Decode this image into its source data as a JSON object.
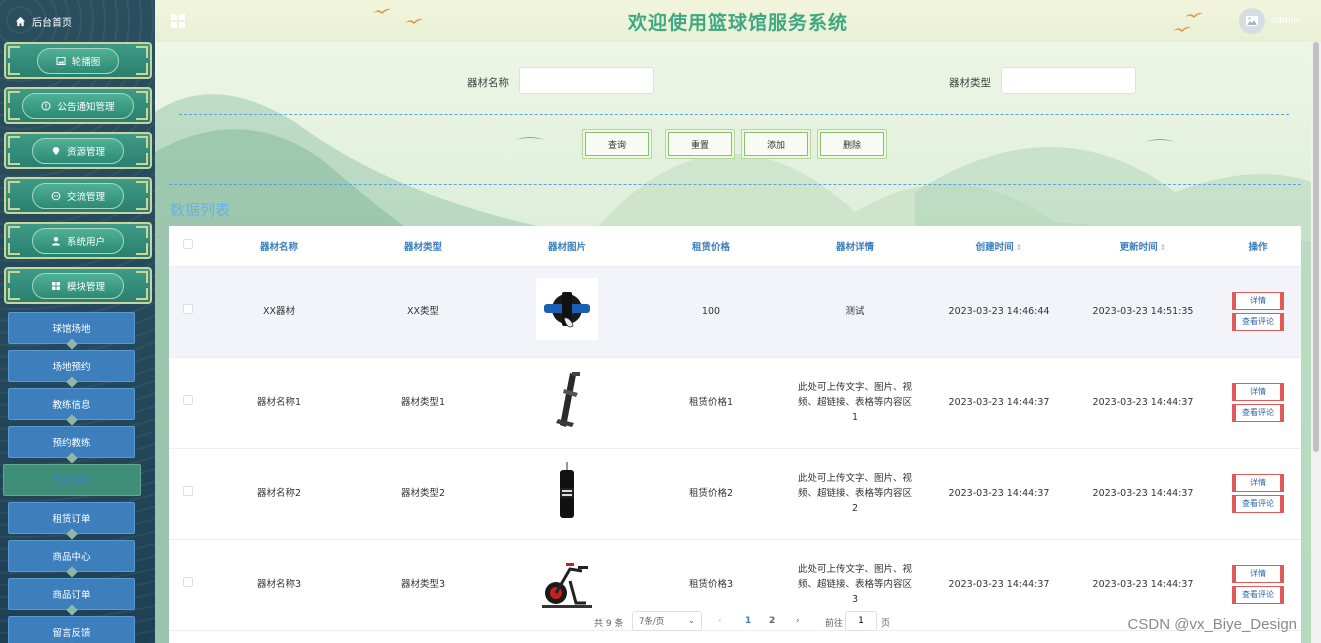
{
  "header": {
    "title": "欢迎使用篮球馆服务系统",
    "username": "admin"
  },
  "sidebar": {
    "home": "后台首页",
    "groups": [
      {
        "label": "轮播图",
        "icon": "image-icon"
      },
      {
        "label": "公告通知管理",
        "icon": "info-circle-icon"
      },
      {
        "label": "资源管理",
        "icon": "location-pin-icon"
      },
      {
        "label": "交流管理",
        "icon": "chat-bubble-icon"
      },
      {
        "label": "系统用户",
        "icon": "user-icon"
      },
      {
        "label": "模块管理",
        "icon": "grid-icon"
      }
    ],
    "items": [
      {
        "label": "球馆场地"
      },
      {
        "label": "场地预约"
      },
      {
        "label": "教练信息"
      },
      {
        "label": "预约教练"
      },
      {
        "label": "租赁器材",
        "active": true
      },
      {
        "label": "租赁订单"
      },
      {
        "label": "商品中心"
      },
      {
        "label": "商品订单"
      },
      {
        "label": "留言反馈"
      }
    ]
  },
  "search": {
    "name_label": "器材名称",
    "name_value": "",
    "type_label": "器材类型",
    "type_value": ""
  },
  "buttons": {
    "query": "查询",
    "reset": "重置",
    "add": "添加",
    "delete": "删除"
  },
  "section_title": "数据列表",
  "table": {
    "columns": [
      "器材名称",
      "器材类型",
      "器材图片",
      "租赁价格",
      "器材详情",
      "创建时间",
      "更新时间",
      "操作"
    ],
    "rows": [
      {
        "name": "XX器材",
        "type": "XX类型",
        "image": "ab-roller-wheel",
        "price": "100",
        "detail": "测试",
        "created": "2023-03-23 14:46:44",
        "updated": "2023-03-23 14:51:35"
      },
      {
        "name": "器材名称1",
        "type": "器材类型1",
        "image": "folding-treadmill",
        "price": "租赁价格1",
        "detail": "此处可上传文字、图片、视频、超链接、表格等内容区1",
        "created": "2023-03-23 14:44:37",
        "updated": "2023-03-23 14:44:37"
      },
      {
        "name": "器材名称2",
        "type": "器材类型2",
        "image": "punching-bag",
        "price": "租赁价格2",
        "detail": "此处可上传文字、图片、视频、超链接、表格等内容区2",
        "created": "2023-03-23 14:44:37",
        "updated": "2023-03-23 14:44:37"
      },
      {
        "name": "器材名称3",
        "type": "器材类型3",
        "image": "spin-bike",
        "price": "租赁价格3",
        "detail": "此处可上传文字、图片、视频、超链接、表格等内容区3",
        "created": "2023-03-23 14:44:37",
        "updated": "2023-03-23 14:44:37"
      }
    ],
    "actions": {
      "detail": "详情",
      "comments": "查看评论"
    }
  },
  "pagination": {
    "total": "共 9 条",
    "page_size": "7条/页",
    "pages": [
      "1",
      "2"
    ],
    "current": "1",
    "goto_prefix": "前往",
    "goto_value": "1",
    "goto_suffix": "页"
  },
  "watermark": "CSDN @vx_Biye_Design",
  "colors": {
    "title": "#3fa883",
    "accent_blue": "#3d7fbd",
    "sidebar_bg": "#2b4f5f",
    "menu_green": "#3e9b86"
  }
}
